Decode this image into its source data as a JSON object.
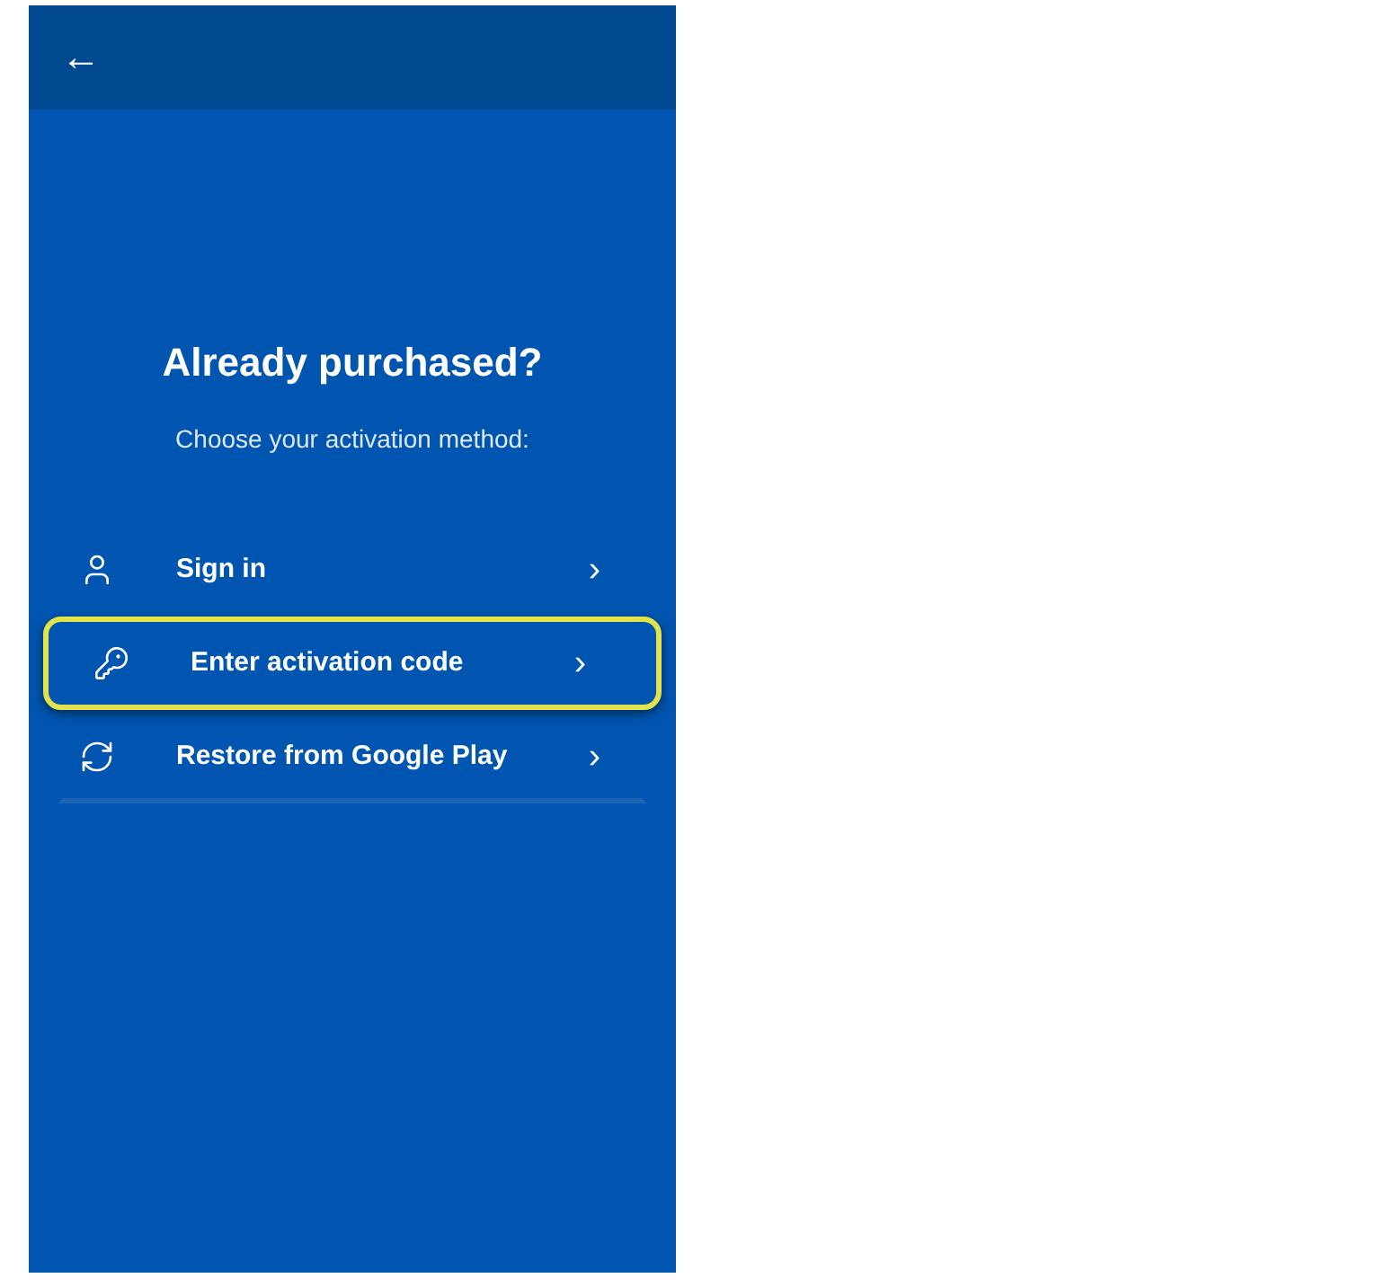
{
  "header": {
    "back": "←"
  },
  "title": "Already purchased?",
  "subtitle": "Choose your activation method:",
  "options": [
    {
      "kind": "user",
      "label": "Sign in",
      "chevron": "›",
      "highlighted": false
    },
    {
      "kind": "key",
      "label": "Enter activation code",
      "chevron": "›",
      "highlighted": true
    },
    {
      "kind": "sync",
      "label": "Restore from Google Play",
      "chevron": "›",
      "highlighted": false
    }
  ]
}
